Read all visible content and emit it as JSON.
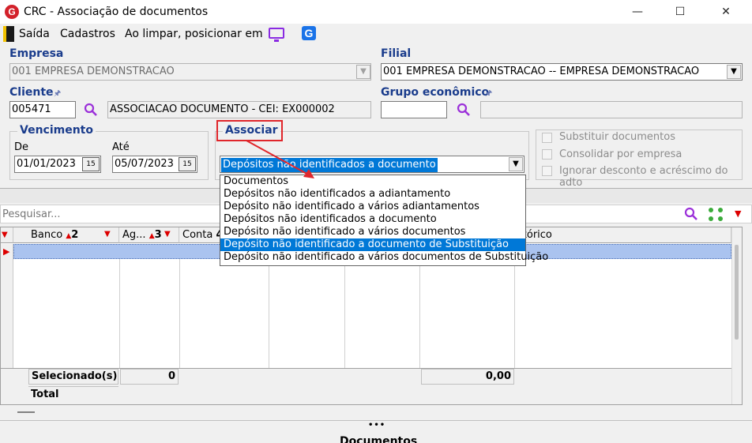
{
  "window": {
    "title": "CRC - Associação de documentos",
    "logo_letter": "G",
    "minimize": "—",
    "maximize": "☐",
    "close": "✕"
  },
  "toolbar": {
    "exit": "Saída",
    "registrations": "Cadastros",
    "on_clear": "Ao limpar, posicionar em",
    "monitor_icon": "monitor-icon",
    "g_icon": "g-app-icon",
    "g_letter": "G"
  },
  "empresa": {
    "label": "Empresa",
    "value": "001 EMPRESA DEMONSTRACAO"
  },
  "filial": {
    "label": "Filial",
    "value": "001 EMPRESA DEMONSTRACAO -- EMPRESA DEMONSTRACAO"
  },
  "cliente": {
    "label": "Cliente",
    "code": "005471",
    "name": "ASSOCIACAO DOCUMENTO - CEI: EX000002"
  },
  "grupo": {
    "label": "Grupo econômico",
    "code": "",
    "name": ""
  },
  "vencimento": {
    "label": "Vencimento",
    "from_label": "De",
    "from_value": "01/01/2023",
    "to_label": "Até",
    "to_value": "05/07/2023",
    "cal_text": "15"
  },
  "associar": {
    "label": "Associar",
    "selected": "Depósitos não identificados a documento",
    "options": [
      "Documentos",
      "Depósitos não identificados a adiantamento",
      "Depósito não identificado a vários adiantamentos",
      "Depósitos não identificados a documento",
      "Depósito não identificado a vários documentos",
      "Depósito não identificado a documento de Substituição",
      "Depósito não identificado a vários documentos de Substituição"
    ],
    "highlighted_index": 5
  },
  "options": {
    "substituir": "Substituir documentos",
    "consolidar": "Consolidar por empresa",
    "ignorar": "Ignorar desconto e acréscimo do adto"
  },
  "search": {
    "placeholder": "Pesquisar..."
  },
  "grid": {
    "columns": [
      {
        "label": "Banco",
        "sort": "2"
      },
      {
        "label": "Ag...",
        "sort": "3"
      },
      {
        "label": "Conta",
        "sort": "4"
      },
      {
        "label": "Histórico",
        "visible_text": "stórico"
      }
    ],
    "summary": {
      "selected_label": "Selecionado(s)",
      "selected_count": "0",
      "selected_total": "0,00",
      "total_label": "Total"
    }
  },
  "bottom": {
    "dots": "•••",
    "section_label": "Documentos"
  },
  "colors": {
    "accent_blue": "#1a3c8c",
    "selection": "#0078d7",
    "highlight_box": "#e0262b",
    "arrow": "#e0262b",
    "row_selected": "#aac3ef"
  }
}
